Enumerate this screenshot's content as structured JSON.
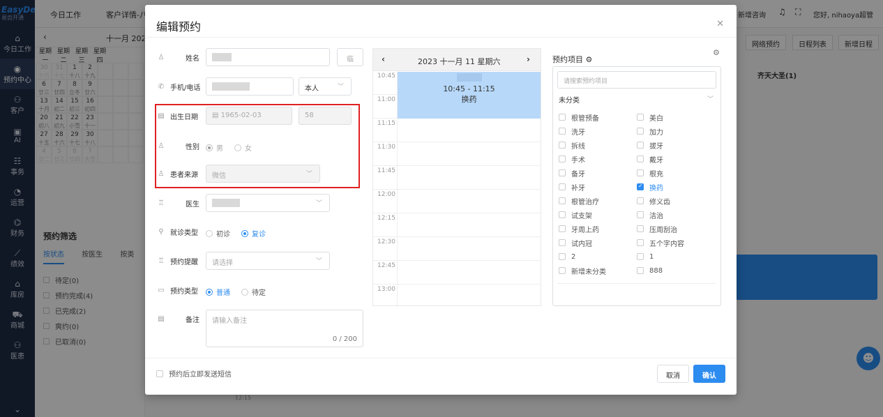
{
  "app": {
    "brand": "EasyDent",
    "brand_sub": "易齿开通"
  },
  "nav": [
    {
      "icon": "⌂",
      "label": "今日工作",
      "name": "nav-today"
    },
    {
      "icon": "◉",
      "label": "预约中心",
      "name": "nav-booking"
    },
    {
      "icon": "⚇",
      "label": "客户",
      "name": "nav-customer"
    },
    {
      "icon": "▣",
      "label": "AI",
      "name": "nav-ai"
    },
    {
      "icon": "☷",
      "label": "事务",
      "name": "nav-affairs"
    },
    {
      "icon": "◔",
      "label": "运营",
      "name": "nav-ops"
    },
    {
      "icon": "⌬",
      "label": "财务",
      "name": "nav-finance"
    },
    {
      "icon": "⟋",
      "label": "绩效",
      "name": "nav-perf"
    },
    {
      "icon": "⌂",
      "label": "库房",
      "name": "nav-store"
    },
    {
      "icon": "⛟",
      "label": "商城",
      "name": "nav-mall"
    },
    {
      "icon": "⚇",
      "label": "医患",
      "name": "nav-doctor"
    }
  ],
  "topbar": {
    "tabs": [
      "今日工作",
      "客户详情-八"
    ],
    "new_consult": "新增咨询",
    "greeting": "您好, nihaoya超管"
  },
  "calendar": {
    "month": "十一月 202",
    "weekdays": [
      "星期一",
      "星期二",
      "星期三",
      "星期四"
    ],
    "rows": [
      [
        {
          "d": "30",
          "l": "十六",
          "dim": true
        },
        {
          "d": "31",
          "l": "十七",
          "dim": true
        },
        {
          "d": "1",
          "l": "十八"
        },
        {
          "d": "2",
          "l": "十九"
        },
        {
          "d": "",
          "l": ""
        },
        {
          "d": "",
          "l": ""
        },
        {
          "d": "",
          "l": ""
        }
      ],
      [
        {
          "d": "6",
          "l": "廿三"
        },
        {
          "d": "7",
          "l": "廿四"
        },
        {
          "d": "8",
          "l": "立冬"
        },
        {
          "d": "9",
          "l": "廿六"
        },
        {
          "d": "",
          "l": ""
        },
        {
          "d": "",
          "l": ""
        },
        {
          "d": "",
          "l": ""
        }
      ],
      [
        {
          "d": "13",
          "l": "十月"
        },
        {
          "d": "14",
          "l": "初二"
        },
        {
          "d": "15",
          "l": "初三"
        },
        {
          "d": "16",
          "l": "初四"
        },
        {
          "d": "",
          "l": ""
        },
        {
          "d": "",
          "l": ""
        },
        {
          "d": "",
          "l": ""
        }
      ],
      [
        {
          "d": "20",
          "l": "初八"
        },
        {
          "d": "21",
          "l": "初九"
        },
        {
          "d": "22",
          "l": "小雪"
        },
        {
          "d": "23",
          "l": "十一"
        },
        {
          "d": "",
          "l": ""
        },
        {
          "d": "",
          "l": ""
        },
        {
          "d": "",
          "l": ""
        }
      ],
      [
        {
          "d": "27",
          "l": "十五"
        },
        {
          "d": "28",
          "l": "十六"
        },
        {
          "d": "29",
          "l": "十七"
        },
        {
          "d": "30",
          "l": "十八"
        },
        {
          "d": "",
          "l": ""
        },
        {
          "d": "",
          "l": ""
        },
        {
          "d": "",
          "l": ""
        }
      ],
      [
        {
          "d": "4",
          "l": "廿二",
          "dim": true
        },
        {
          "d": "5",
          "l": "廿三",
          "dim": true
        },
        {
          "d": "6",
          "l": "廿四",
          "dim": true
        },
        {
          "d": "7",
          "l": "大雪",
          "dim": true
        },
        {
          "d": "",
          "l": ""
        },
        {
          "d": "",
          "l": ""
        },
        {
          "d": "",
          "l": ""
        }
      ]
    ]
  },
  "filter": {
    "title": "预约筛选",
    "tabs": [
      "按状态",
      "按医生",
      "按类"
    ],
    "statuses": [
      "待定(0)",
      "预约完成(4)",
      "已完成(2)",
      "爽约(0)",
      "已取消(0)"
    ]
  },
  "main": {
    "buttons": [
      "网络预约",
      "日程列表",
      "新增日程"
    ],
    "column_head": "齐天大圣(1)",
    "bg_time": "12:15"
  },
  "modal": {
    "title": "编辑预约",
    "name_label": "姓名",
    "name_btn": "临",
    "phone_label": "手机/电话",
    "phone_relation": "本人",
    "birth_label": "出生日期",
    "birth_value": "1965-02-03",
    "age_value": "58",
    "gender_label": "性别",
    "gender_male": "男",
    "gender_female": "女",
    "source_label": "患者来源",
    "source_value": "微信",
    "doctor_label": "医生",
    "visit_label": "就诊类型",
    "visit_first": "初诊",
    "visit_return": "复诊",
    "reminder_label": "预约提醒",
    "reminder_placeholder": "请选择",
    "type_label": "预约类型",
    "type_normal": "普通",
    "type_pending": "待定",
    "note_label": "备注",
    "note_placeholder": "请输入备注",
    "note_count": "0 / 200",
    "sms_label": "预约后立即发送短信",
    "cancel": "取消",
    "confirm": "确认"
  },
  "schedule": {
    "date": "2023 十一月 11 星期六",
    "times": [
      "10:45",
      "11:00",
      "11:15",
      "11:30",
      "11:45",
      "12:00",
      "12:15",
      "12:30",
      "12:45",
      "13:00"
    ],
    "appt_time": "10:45 - 11:15",
    "appt_name": "换药"
  },
  "projects": {
    "title": "预约项目",
    "search_placeholder": "请搜索预约项目",
    "category": "未分类",
    "items": [
      {
        "label": "根管预备",
        "checked": false
      },
      {
        "label": "美白",
        "checked": false
      },
      {
        "label": "洗牙",
        "checked": false
      },
      {
        "label": "加力",
        "checked": false
      },
      {
        "label": "拆线",
        "checked": false
      },
      {
        "label": "拔牙",
        "checked": false
      },
      {
        "label": "手术",
        "checked": false
      },
      {
        "label": "戴牙",
        "checked": false
      },
      {
        "label": "备牙",
        "checked": false
      },
      {
        "label": "根充",
        "checked": false
      },
      {
        "label": "补牙",
        "checked": false
      },
      {
        "label": "换药",
        "checked": true
      },
      {
        "label": "根管治疗",
        "checked": false
      },
      {
        "label": "修义齿",
        "checked": false
      },
      {
        "label": "试支架",
        "checked": false
      },
      {
        "label": "洁治",
        "checked": false
      },
      {
        "label": "牙周上药",
        "checked": false
      },
      {
        "label": "压周刮治",
        "checked": false
      },
      {
        "label": "试内冠",
        "checked": false
      },
      {
        "label": "五个字内容",
        "checked": false
      },
      {
        "label": "2",
        "checked": false
      },
      {
        "label": "1",
        "checked": false
      },
      {
        "label": "新增未分类",
        "checked": false
      },
      {
        "label": "888",
        "checked": false
      }
    ]
  }
}
